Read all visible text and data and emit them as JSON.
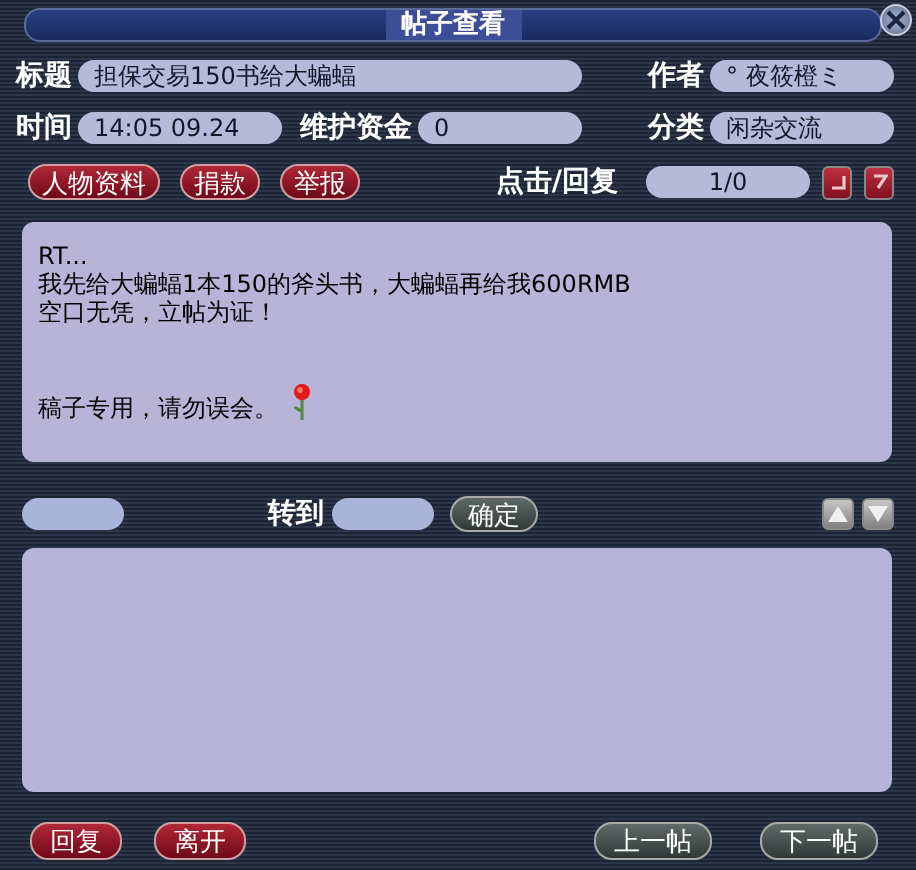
{
  "window": {
    "title": "帖子查看"
  },
  "info_rows": [
    [
      {
        "label": "标题",
        "value": "担保交易150书给大蝙蝠"
      },
      {
        "label": "作者",
        "value": "° 夜筱橙ミ"
      }
    ],
    [
      {
        "label": "时间",
        "value": "14:05 09.24"
      },
      {
        "label": "维护资金",
        "value": "0"
      },
      {
        "label": "分类",
        "value": "闲杂交流"
      }
    ]
  ],
  "action_buttons": [
    {
      "label": "人物资料"
    },
    {
      "label": "捐款"
    },
    {
      "label": "举报"
    }
  ],
  "stats": {
    "label": "点击/回复",
    "value": "1/0"
  },
  "post_body": [
    {
      "lines": [
        "RT...",
        "我先给大蝙蝠1本150的斧头书，大蝙蝠再给我600RMB",
        "空口无凭，立帖为证！"
      ]
    },
    {
      "lines": [
        "稿子专用，请勿误会。"
      ]
    }
  ],
  "goto": {
    "label": "转到",
    "confirm": "确定"
  },
  "bottom_left": [
    {
      "label": "回复"
    },
    {
      "label": "离开"
    }
  ],
  "bottom_right": [
    {
      "label": "上一帖"
    },
    {
      "label": "下一帖"
    }
  ]
}
